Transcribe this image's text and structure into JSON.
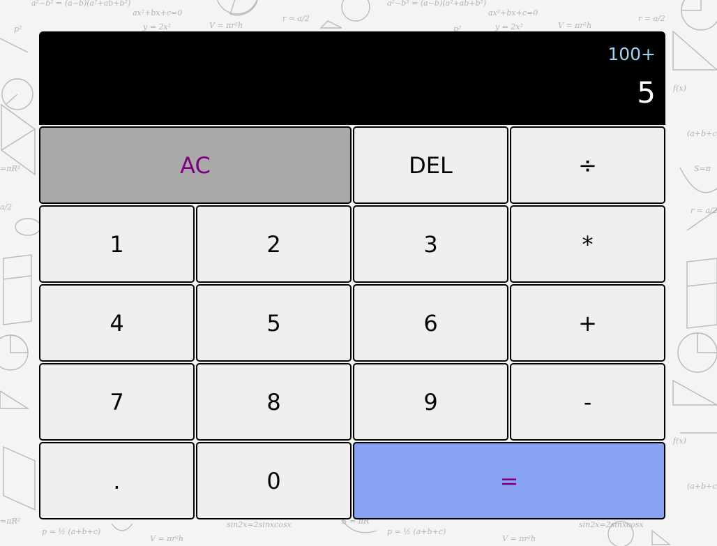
{
  "display": {
    "previous_operand": "100+",
    "current_operand": "5"
  },
  "keys": {
    "all_clear": "AC",
    "delete": "DEL",
    "divide": "÷",
    "one": "1",
    "two": "2",
    "three": "3",
    "multiply": "*",
    "four": "4",
    "five": "5",
    "six": "6",
    "add": "+",
    "seven": "7",
    "eight": "8",
    "nine": "9",
    "subtract": "-",
    "decimal": ".",
    "zero": "0",
    "equals": "="
  },
  "colors": {
    "display_background": "#000000",
    "previous_operand_text": "#9fd3ee",
    "current_operand_text": "#ffffff",
    "key_background": "#efefef",
    "ac_background": "#a9a9a9",
    "equals_background": "#88a3f1",
    "accent_text": "#800080"
  }
}
